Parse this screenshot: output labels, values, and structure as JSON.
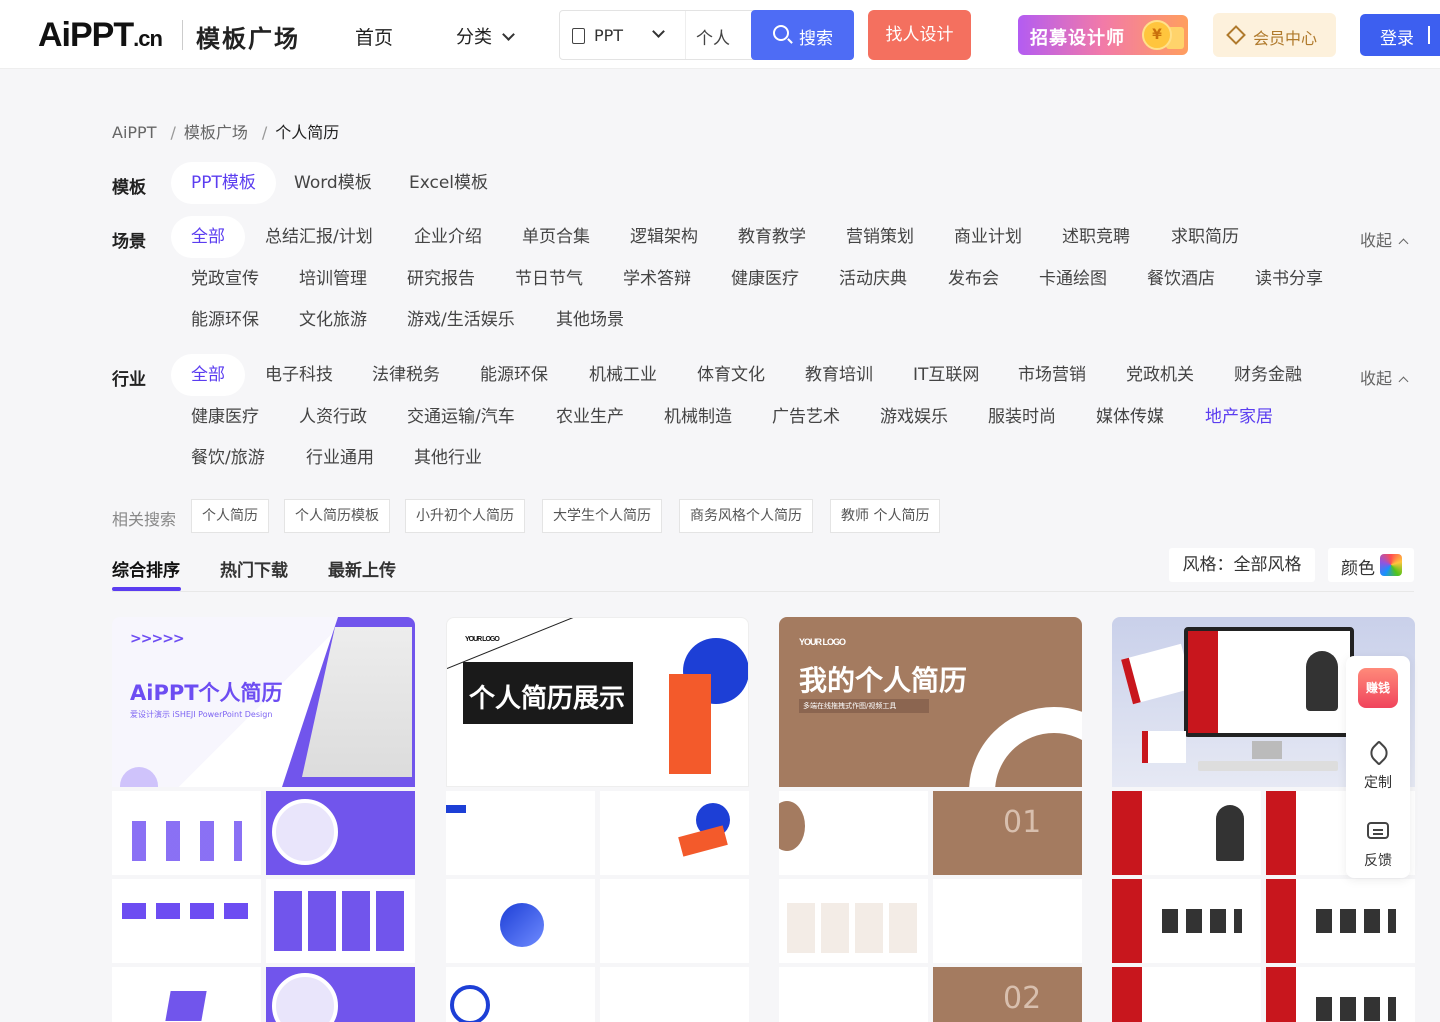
{
  "header": {
    "logo_main": "AiPPT",
    "logo_cn": ".cn",
    "logo_sub": "模板广场",
    "nav_home": "首页",
    "nav_category": "分类",
    "search_type": "PPT",
    "search_value": "个人",
    "search_button": "搜索",
    "design_button": "找人设计",
    "recruit_button": "招募设计师",
    "member_button": "会员中心",
    "login_button": "登录"
  },
  "breadcrumb": [
    "AiPPT",
    "模板广场",
    "个人简历"
  ],
  "filters": {
    "template": {
      "label": "模板",
      "items": [
        "PPT模板",
        "Word模板",
        "Excel模板"
      ]
    },
    "scene": {
      "label": "场景",
      "items": [
        "全部",
        "总结汇报/计划",
        "企业介绍",
        "单页合集",
        "逻辑架构",
        "教育教学",
        "营销策划",
        "商业计划",
        "述职竞聘",
        "求职简历",
        "党政宣传",
        "培训管理",
        "研究报告",
        "节日节气",
        "学术答辩",
        "健康医疗",
        "活动庆典",
        "发布会",
        "卡通绘图",
        "餐饮酒店",
        "读书分享",
        "能源环保",
        "文化旅游",
        "游戏/生活娱乐",
        "其他场景"
      ],
      "collapse": "收起"
    },
    "industry": {
      "label": "行业",
      "items": [
        "全部",
        "电子科技",
        "法律税务",
        "能源环保",
        "机械工业",
        "体育文化",
        "教育培训",
        "IT互联网",
        "市场营销",
        "党政机关",
        "财务金融",
        "健康医疗",
        "人资行政",
        "交通运输/汽车",
        "农业生产",
        "机械制造",
        "广告艺术",
        "游戏娱乐",
        "服装时尚",
        "媒体传媒",
        "地产家居",
        "餐饮/旅游",
        "行业通用",
        "其他行业"
      ],
      "collapse": "收起"
    }
  },
  "related": {
    "label": "相关搜索",
    "tags": [
      "个人简历",
      "个人简历模板",
      "小升初个人简历",
      "大学生个人简历",
      "商务风格个人简历",
      "教师 个人简历"
    ]
  },
  "sort": {
    "tabs": [
      "综合排序",
      "热门下载",
      "最新上传"
    ],
    "style_button": "风格：全部风格",
    "color_button": "颜色"
  },
  "cards": [
    {
      "title": "AiPPT个人简历",
      "subtitle": "爱设计演示 iSHEJI PowerPoint Design",
      "arrows": ">>>>>"
    },
    {
      "title": "个人简历展示",
      "logo": "YOUR LOGO"
    },
    {
      "title": "我的个人简历",
      "logo": "YOUR LOGO",
      "subtitle": "多端在线拖拽式作图/视频工具"
    },
    {
      "title": ""
    }
  ],
  "float_panel": {
    "earn": "赚钱",
    "custom": "定制",
    "feedback": "反馈"
  },
  "colors": {
    "accent": "#5b3df0",
    "search_button": "#4e6cf5",
    "design_button": "#f4705f",
    "login_button": "#3d5ff0"
  }
}
